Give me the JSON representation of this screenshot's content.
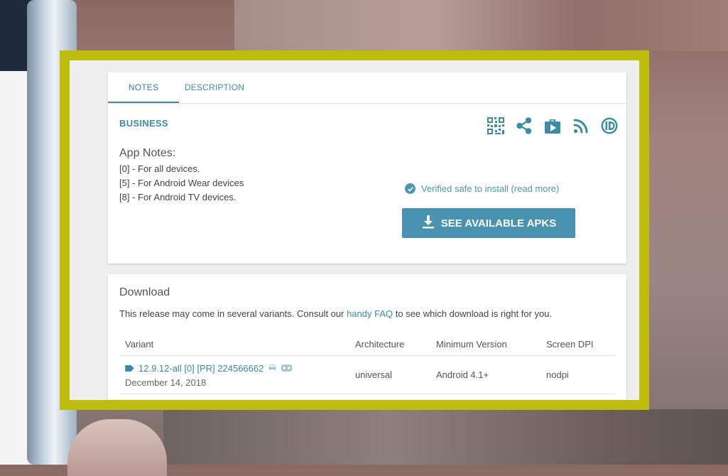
{
  "tabs": {
    "notes": "NOTES",
    "description": "DESCRIPTION"
  },
  "category": "BUSINESS",
  "action_icons": [
    "qr-code-icon",
    "share-icon",
    "play-store-icon",
    "rss-icon",
    "id-icon"
  ],
  "app_notes": {
    "title": "App Notes:",
    "lines": [
      "[0] - For all devices.",
      "[5] - For Android Wear devices",
      "[8] - For Android TV devices."
    ]
  },
  "verified_text": "Verified safe to install (read more)",
  "apk_button_label": "SEE AVAILABLE APKS",
  "download": {
    "title": "Download",
    "desc_before": "This release may come in several variants. Consult our ",
    "desc_link": "handy FAQ",
    "desc_after": " to see which download is right for you.",
    "columns": [
      "Variant",
      "Architecture",
      "Minimum Version",
      "Screen DPI"
    ],
    "rows": [
      {
        "variant": "12.9.12-all [0] [PR] 224566662",
        "date": "December 14, 2018",
        "architecture": "universal",
        "min_version": "Android 4.1+",
        "dpi": "nodpi"
      }
    ]
  },
  "colors": {
    "accent": "#4793b1",
    "frame": "#bfbd0c"
  }
}
